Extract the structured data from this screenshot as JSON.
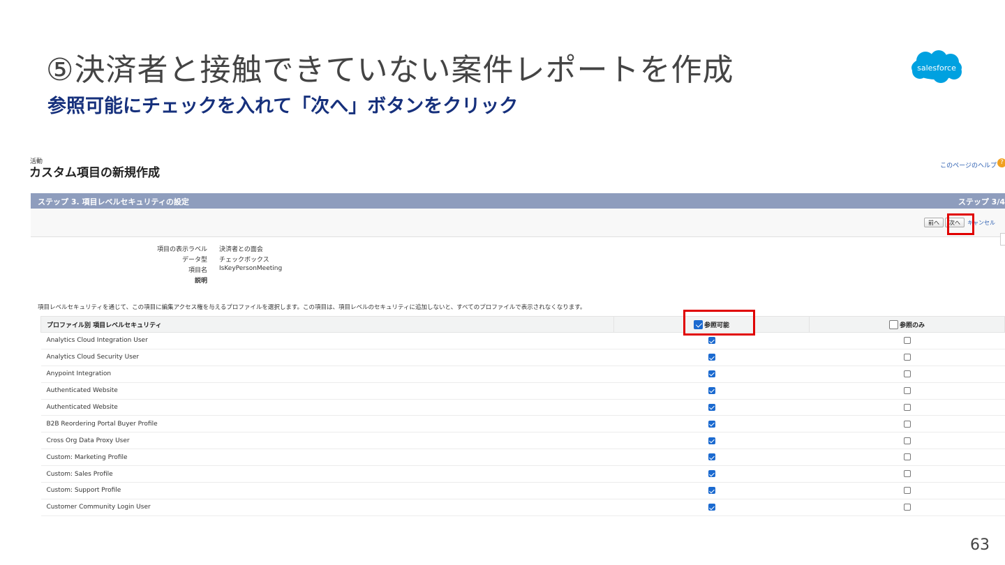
{
  "slide": {
    "title": "⑤決済者と接触できていない案件レポートを作成",
    "subtitle": "参照可能にチェックを入れて「次へ」ボタンをクリック",
    "page_number": "63",
    "logo_text": "salesforce",
    "logo_color": "#00a1e0"
  },
  "screen": {
    "breadcrumb": "活動",
    "page_title": "カスタム項目の新規作成",
    "help_link": "このページのヘルプ",
    "step_title": "ステップ 3. 項目レベルセキュリティの設定",
    "step_counter": "ステップ 3/4",
    "buttons": {
      "prev": "前へ",
      "next": "次へ",
      "cancel": "キャンセル"
    },
    "field_info": [
      {
        "label": "項目の表示ラベル",
        "value": "決済者との面会"
      },
      {
        "label": "データ型",
        "value": "チェックボックス"
      },
      {
        "label": "項目名",
        "value": "IsKeyPersonMeeting"
      },
      {
        "label": "説明",
        "value": ""
      }
    ],
    "description": "項目レベルセキュリティを通じて、この項目に編集アクセス権を与えるプロファイルを選択します。この項目は、項目レベルのセキュリティに追加しないと、すべてのプロファイルで表示されなくなります。",
    "table": {
      "headers": {
        "profile": "プロファイル別 項目レベルセキュリティ",
        "visible": "参照可能",
        "readonly": "参照のみ"
      },
      "header_visible_checked": true,
      "header_readonly_checked": false,
      "rows": [
        {
          "profile": "Analytics Cloud Integration User",
          "visible": true,
          "readonly": false
        },
        {
          "profile": "Analytics Cloud Security User",
          "visible": true,
          "readonly": false
        },
        {
          "profile": "Anypoint Integration",
          "visible": true,
          "readonly": false
        },
        {
          "profile": "Authenticated Website",
          "visible": true,
          "readonly": false
        },
        {
          "profile": "Authenticated Website",
          "visible": true,
          "readonly": false
        },
        {
          "profile": "B2B Reordering Portal Buyer Profile",
          "visible": true,
          "readonly": false
        },
        {
          "profile": "Cross Org Data Proxy User",
          "visible": true,
          "readonly": false
        },
        {
          "profile": "Custom: Marketing Profile",
          "visible": true,
          "readonly": false
        },
        {
          "profile": "Custom: Sales Profile",
          "visible": true,
          "readonly": false
        },
        {
          "profile": "Custom: Support Profile",
          "visible": true,
          "readonly": false
        },
        {
          "profile": "Customer Community Login User",
          "visible": true,
          "readonly": false
        }
      ]
    }
  },
  "colors": {
    "highlight": "#e00000",
    "header_bar": "#8e9dbd",
    "subtitle": "#16307c",
    "checkbox": "#1b6ad0"
  }
}
